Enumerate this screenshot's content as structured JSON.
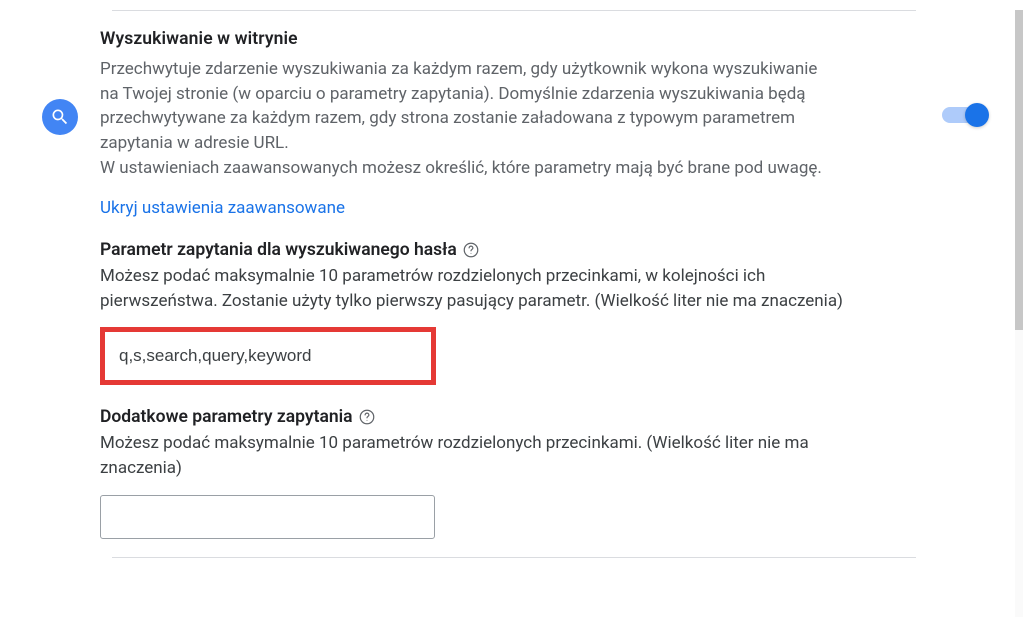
{
  "section": {
    "title": "Wyszukiwanie w witrynie",
    "description": "Przechwytuje zdarzenie wyszukiwania za każdym razem, gdy użytkownik wykona wyszukiwanie na Twojej stronie (w oparciu o parametry zapytania). Domyślnie zdarzenia wyszukiwania będą przechwytywane za każdym razem, gdy strona zostanie załadowana z typowym parametrem zapytania w adresie URL.\nW ustawieniach zaawansowanych możesz określić, które parametry mają być brane pod uwagę.",
    "toggle_on": true,
    "advanced_link": "Ukryj ustawienia zaawansowane",
    "query_param": {
      "title": "Parametr zapytania dla wyszukiwanego hasła",
      "description": "Możesz podać maksymalnie 10 parametrów rozdzielonych przecinkami, w kolejności ich pierwszeństwa. Zostanie użyty tylko pierwszy pasujący parametr. (Wielkość liter nie ma znaczenia)",
      "value": "q,s,search,query,keyword"
    },
    "extra_param": {
      "title": "Dodatkowe parametry zapytania",
      "description": "Możesz podać maksymalnie 10 parametrów rozdzielonych przecinkami. (Wielkość liter nie ma znaczenia)",
      "value": ""
    }
  }
}
